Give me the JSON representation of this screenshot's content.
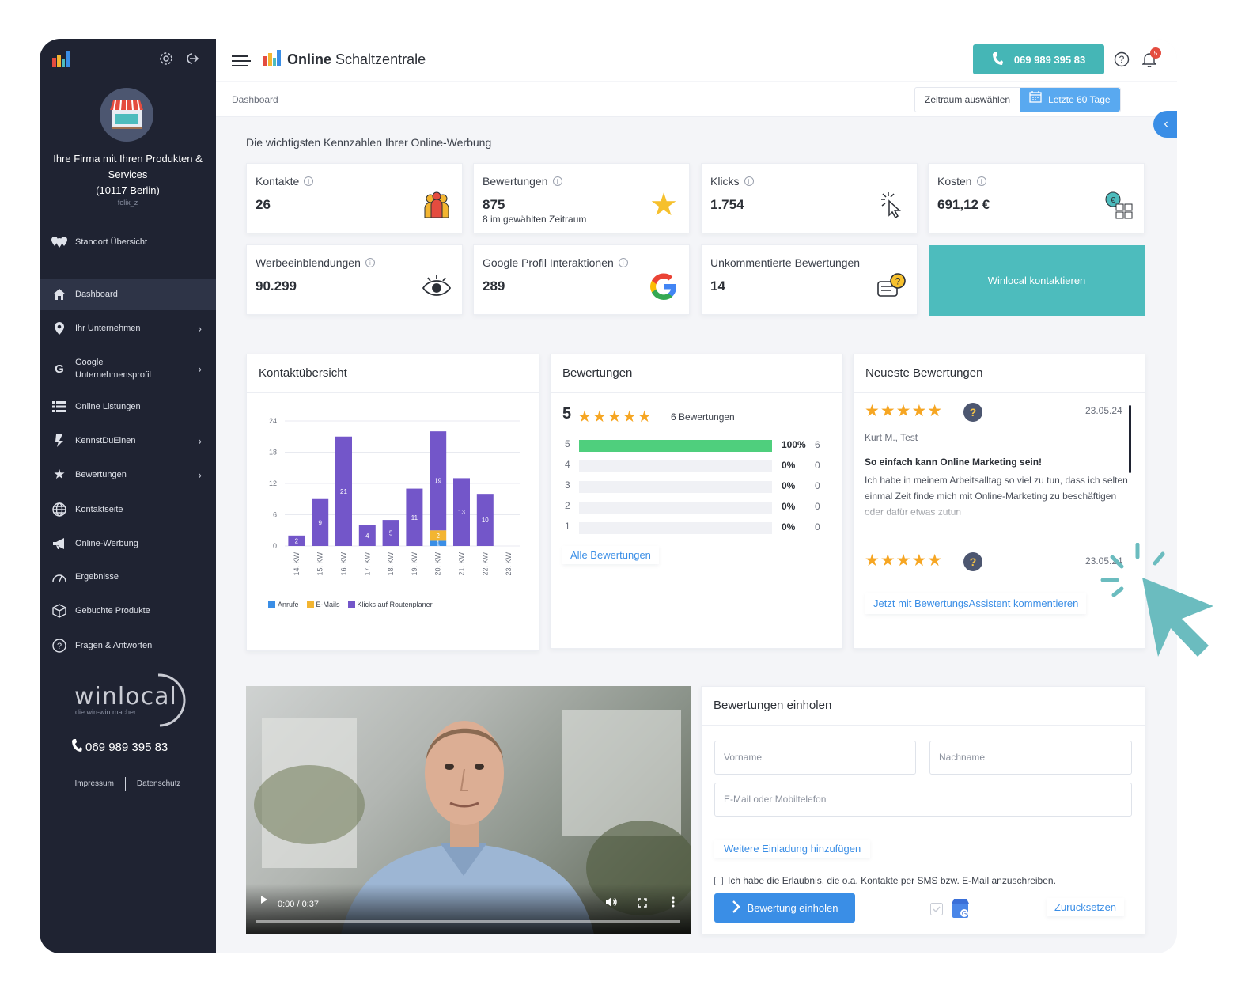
{
  "colors": {
    "sidebar_bg": "#1f2332",
    "accent_teal": "#45b6b6",
    "accent_blue": "#3a8ee6",
    "star_orange": "#f6a623",
    "bar_purple": "#7356c9",
    "bar_blue": "#3a8ee6",
    "bar_yellow": "#f3b531",
    "rating_green": "#4fcf7d"
  },
  "sidebar": {
    "company_name": "Ihre Firma mit Ihren Produkten & Services",
    "company_location": "(10117 Berlin)",
    "user": "felix_z",
    "items": [
      {
        "label": "Standort Übersicht",
        "icon": "map-markers-icon",
        "chevron": false
      },
      {
        "label": "Dashboard",
        "icon": "home-icon",
        "chevron": false,
        "active": true
      },
      {
        "label": "Ihr Unternehmen",
        "icon": "location-pin-icon",
        "chevron": true
      },
      {
        "label": "Google",
        "label2": "Unternehmensprofil",
        "icon": "google-icon",
        "chevron": true
      },
      {
        "label": "Online Listungen",
        "icon": "list-icon",
        "chevron": false
      },
      {
        "label": "KennstDuEinen",
        "icon": "kennstdueinen-icon",
        "chevron": true
      },
      {
        "label": "Bewertungen",
        "icon": "star-icon",
        "chevron": true
      },
      {
        "label": "Kontaktseite",
        "icon": "globe-icon",
        "chevron": false
      },
      {
        "label": "Online-Werbung",
        "icon": "megaphone-icon",
        "chevron": false
      },
      {
        "label": "Ergebnisse",
        "icon": "gauge-icon",
        "chevron": false
      },
      {
        "label": "Gebuchte Produkte",
        "icon": "box-icon",
        "chevron": false
      },
      {
        "label": "Fragen & Antworten",
        "icon": "question-icon",
        "chevron": false
      }
    ],
    "logo_text": "winlocal",
    "logo_tagline": "die win-win macher",
    "phone": "069 989 395 83",
    "footer_links": [
      "Impressum",
      "Datenschutz"
    ]
  },
  "header": {
    "brand_bold": "Online",
    "brand_regular": "Schaltzentrale",
    "phone_button": "069 989 395 83",
    "notification_count": "5"
  },
  "subheader": {
    "breadcrumb": "Dashboard",
    "range_label": "Zeitraum auswählen",
    "range_button": "Letzte 60 Tage"
  },
  "kpi_section_title": "Die wichtigsten Kennzahlen Ihrer Online-Werbung",
  "kpis": [
    {
      "label": "Kontakte",
      "value": "26",
      "icon": "people-icon"
    },
    {
      "label": "Bewertungen",
      "value": "875",
      "sub": "8 im gewählten Zeitraum",
      "icon": "star-icon"
    },
    {
      "label": "Klicks",
      "value": "1.754",
      "icon": "cursor-click-icon"
    },
    {
      "label": "Kosten",
      "value": "691,12 €",
      "icon": "coins-icon"
    },
    {
      "label": "Werbeeinblendungen",
      "value": "90.299",
      "icon": "eye-icon"
    },
    {
      "label": "Google Profil Interaktionen",
      "value": "289",
      "icon": "google-g-icon"
    },
    {
      "label": "Unkommentierte Bewertungen",
      "value": "14",
      "icon": "chat-question-icon"
    }
  ],
  "kpi_cta": "Winlocal kontaktieren",
  "contact_panel": {
    "title": "Kontaktübersicht",
    "legend": [
      "Anrufe",
      "E-Mails",
      "Klicks auf Routenplaner"
    ]
  },
  "chart_data": {
    "type": "bar",
    "stacked": true,
    "categories": [
      "14. KW",
      "15. KW",
      "16. KW",
      "17. KW",
      "18. KW",
      "19. KW",
      "20. KW",
      "21. KW",
      "22. KW",
      "23. KW"
    ],
    "series": [
      {
        "name": "Anrufe",
        "values": [
          0,
          0,
          0,
          0,
          0,
          0,
          1,
          0,
          0,
          0
        ],
        "color": "#3a8ee6"
      },
      {
        "name": "E-Mails",
        "values": [
          0,
          0,
          0,
          0,
          0,
          0,
          2,
          0,
          0,
          0
        ],
        "color": "#f3b531"
      },
      {
        "name": "Klicks auf Routenplaner",
        "values": [
          2,
          9,
          21,
          4,
          5,
          11,
          19,
          13,
          10,
          0
        ],
        "color": "#7356c9"
      }
    ],
    "ylim": [
      0,
      24
    ],
    "yticks": [
      0,
      6,
      12,
      18,
      24
    ],
    "grid": true,
    "legend_position": "bottom-left"
  },
  "ratings_panel": {
    "title": "Bewertungen",
    "average": "5",
    "stars": "★★★★★",
    "count": "6 Bewertungen",
    "rows": [
      {
        "stars": "5",
        "fraction": 1.0,
        "pct": "100%",
        "count": "6"
      },
      {
        "stars": "4",
        "fraction": 0.0,
        "pct": "0%",
        "count": "0"
      },
      {
        "stars": "3",
        "fraction": 0.0,
        "pct": "0%",
        "count": "0"
      },
      {
        "stars": "2",
        "fraction": 0.0,
        "pct": "0%",
        "count": "0"
      },
      {
        "stars": "1",
        "fraction": 0.0,
        "pct": "0%",
        "count": "0"
      }
    ],
    "all_link": "Alle Bewertungen"
  },
  "newest_reviews": {
    "title": "Neueste Bewertungen",
    "reviews": [
      {
        "stars": "★★★★★",
        "date": "23.05.24",
        "author": "Kurt M., Test",
        "headline": "So einfach kann Online Marketing sein!",
        "body": "Ich habe in meinem Arbeitsalltag so viel zu tun, dass ich selten einmal Zeit finde mich mit Online-Marketing zu beschäftigen oder dafür etwas zutun"
      },
      {
        "stars": "★★★★★",
        "date": "23.05.24"
      }
    ],
    "assistant_link": "Jetzt mit BewertungsAssistent kommentieren"
  },
  "video": {
    "time": "0:00 / 0:37",
    "progress": 0.0
  },
  "request_form": {
    "title": "Bewertungen einholen",
    "firstname_placeholder": "Vorname",
    "lastname_placeholder": "Nachname",
    "contact_placeholder": "E-Mail oder Mobiltelefon",
    "more_link": "Weitere Einladung hinzufügen",
    "consent": "Ich habe die Erlaubnis, die o.a. Kontakte per SMS bzw. E-Mail anzuschreiben.",
    "submit": "Bewertung einholen",
    "reset": "Zurücksetzen"
  }
}
